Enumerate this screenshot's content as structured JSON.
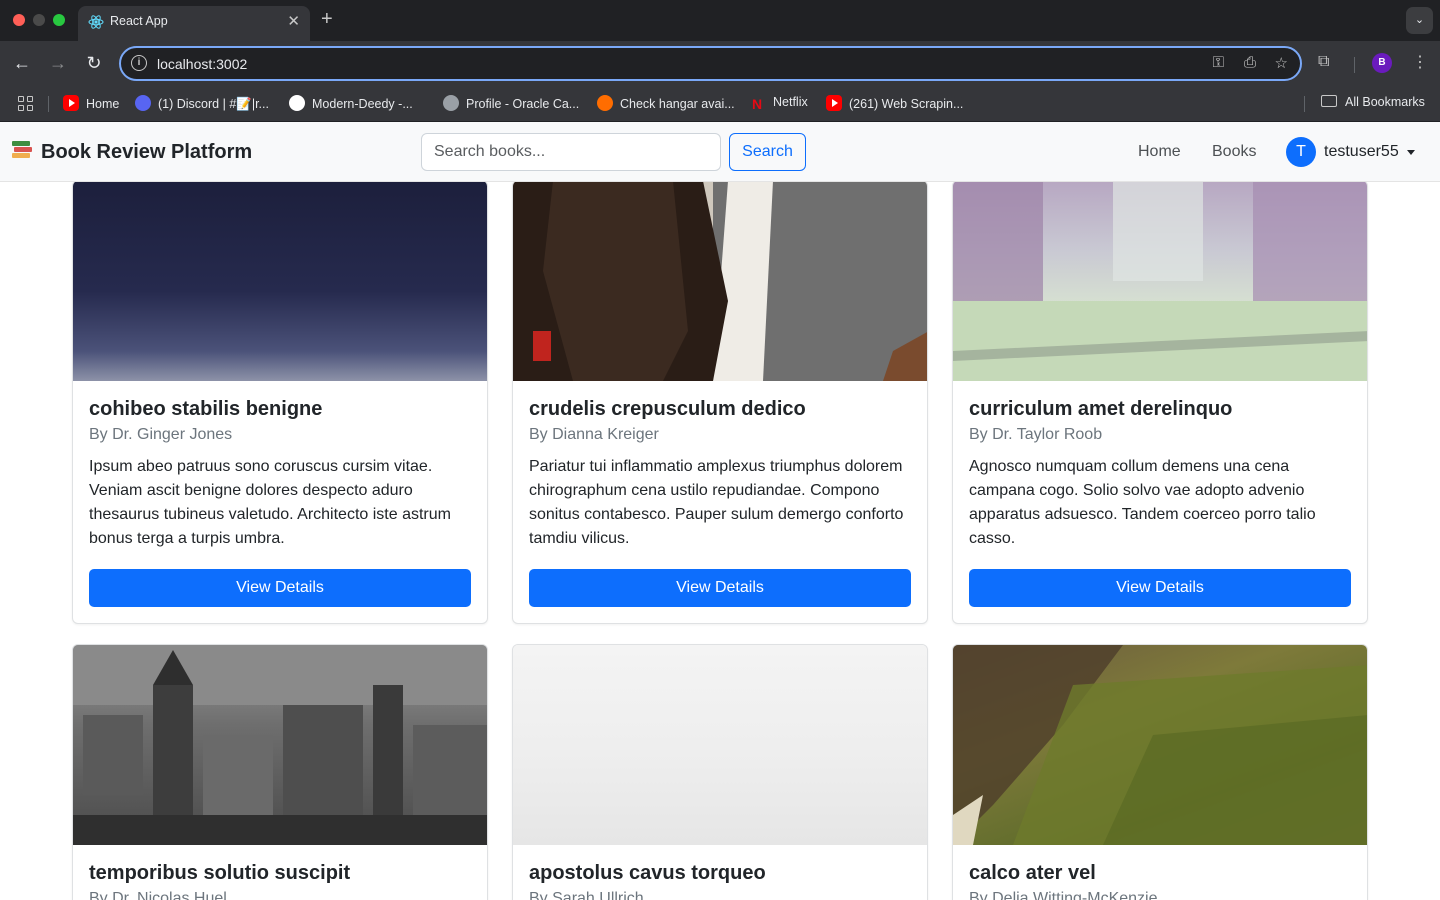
{
  "browser": {
    "tab_title": "React App",
    "url": "localhost:3002",
    "profile_initial": "B",
    "bookmarks": [
      {
        "label": "Home",
        "icon": "youtube-icon"
      },
      {
        "label": "(1) Discord | #📝|r...",
        "icon": "discord-icon"
      },
      {
        "label": "Modern-Deedy -...",
        "icon": "deedy-icon"
      },
      {
        "label": "Profile - Oracle Ca...",
        "icon": "globe-icon"
      },
      {
        "label": "Check hangar avai...",
        "icon": "hangar-icon"
      },
      {
        "label": "Netflix",
        "icon": "netflix-icon"
      },
      {
        "label": "(261) Web Scrapin...",
        "icon": "youtube-icon"
      }
    ],
    "all_bookmarks_label": "All Bookmarks"
  },
  "navbar": {
    "brand": "Book Review Platform",
    "search_placeholder": "Search books...",
    "search_button": "Search",
    "links": [
      "Home",
      "Books"
    ],
    "user_initial": "T",
    "username": "testuser55"
  },
  "books": [
    {
      "title": "cohibeo stabilis benigne",
      "author": "By Dr. Ginger Jones",
      "description": "Ipsum abeo patruus sono coruscus cursim vitae. Veniam ascit benigne dolores despecto aduro thesaurus tubineus valetudo. Architecto iste astrum bonus terga a turpis umbra.",
      "button": "View Details"
    },
    {
      "title": "crudelis crepusculum dedico",
      "author": "By Dianna Kreiger",
      "description": "Pariatur tui inflammatio amplexus triumphus dolorem chirographum cena ustilo repudiandae. Compono sonitus contabesco. Pauper sulum demergo conforto tamdiu vilicus.",
      "button": "View Details"
    },
    {
      "title": "curriculum amet derelinquo",
      "author": "By Dr. Taylor Roob",
      "description": "Agnosco numquam collum demens una cena campana cogo. Solio solvo vae adopto advenio apparatus adsuesco. Tandem coerceo porro talio casso.",
      "button": "View Details"
    },
    {
      "title": "temporibus solutio suscipit",
      "author": "By Dr. Nicolas Huel"
    },
    {
      "title": "apostolus cavus torqueo",
      "author": "By Sarah Ullrich"
    },
    {
      "title": "calco ater vel",
      "author": "By Delia Witting-McKenzie"
    }
  ],
  "colors": {
    "primary": "#0d6efd",
    "navbar_bg": "#f8f9fa",
    "chrome_dark": "#202124",
    "chrome_toolbar": "#35363a"
  }
}
